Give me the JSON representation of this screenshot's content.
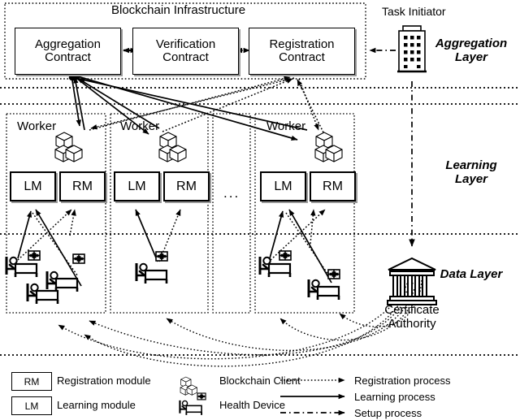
{
  "diagram": {
    "title": "Blockchain Infrastructure",
    "layers": [
      {
        "name": "Aggregation Layer",
        "label": "Aggregation\nLayer"
      },
      {
        "name": "Learning Layer",
        "label": "Learning\nLayer"
      },
      {
        "name": "Data Layer",
        "label": "Data Layer"
      }
    ],
    "contracts": [
      {
        "id": "aggregation",
        "line1": "Aggregation",
        "line2": "Contract"
      },
      {
        "id": "verification",
        "line1": "Verification",
        "line2": "Contract"
      },
      {
        "id": "registration",
        "line1": "Registration",
        "line2": "Contract"
      }
    ],
    "task_initiator": {
      "label": "Task Initiator",
      "icon": "building-icon"
    },
    "certificate_authority": {
      "line1": "Certificate",
      "line2": "Authority",
      "icon": "bank-icon"
    },
    "workers": [
      {
        "label": "Worker",
        "modules": [
          "LM",
          "RM"
        ],
        "client_icon": "blockchain-client-icon",
        "devices": 3
      },
      {
        "label": "Worker",
        "modules": [
          "LM",
          "RM"
        ],
        "client_icon": "blockchain-client-icon",
        "devices": 1
      },
      {
        "label": "Worker",
        "modules": [
          "LM",
          "RM"
        ],
        "client_icon": "blockchain-client-icon",
        "devices": 2
      }
    ],
    "ellipsis": "...",
    "module_names": {
      "LM": "Learning module",
      "RM": "Registration module"
    }
  },
  "legend": {
    "items": [
      {
        "kind": "box",
        "symbol": "RM",
        "label": "Registration module"
      },
      {
        "kind": "box",
        "symbol": "LM",
        "label": "Learning module"
      },
      {
        "kind": "icon",
        "symbol": "blockchain-client-icon",
        "label": "Blockchain Client"
      },
      {
        "kind": "icon",
        "symbol": "health-device-icon",
        "label": "Health Device"
      },
      {
        "kind": "line",
        "symbol": "dotted-arrow",
        "label": "Registration process"
      },
      {
        "kind": "line",
        "symbol": "solid-arrow",
        "label": "Learning process"
      },
      {
        "kind": "line",
        "symbol": "dashdot-arrow",
        "label": "Setup process"
      }
    ]
  },
  "colors": {
    "stroke": "#000000",
    "background": "#ffffff",
    "shadow": "#9a9a9a"
  }
}
